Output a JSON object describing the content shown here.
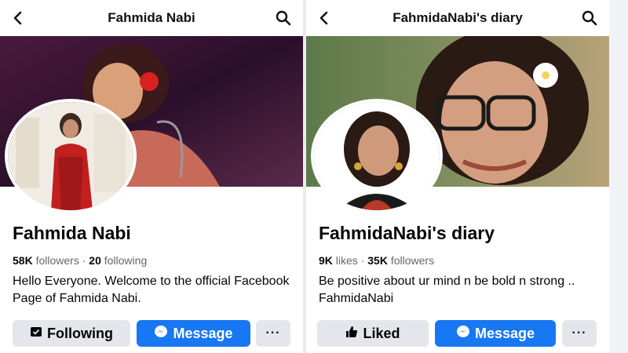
{
  "left": {
    "title": "Fahmida Nabi",
    "name": "Fahmida Nabi",
    "stat1_value": "58K",
    "stat1_label": "followers",
    "separator": "·",
    "stat2_value": "20",
    "stat2_label": "following",
    "bio": "Hello Everyone. Welcome to the official Facebook Page of Fahmida Nabi.",
    "primary_button": "Following",
    "message_button": "Message",
    "more_button": "···",
    "primary_icon": "following-icon"
  },
  "right": {
    "title": "FahmidaNabi's diary",
    "name": "FahmidaNabi's diary",
    "stat1_value": "9K",
    "stat1_label": "likes",
    "separator": "·",
    "stat2_value": "35K",
    "stat2_label": "followers",
    "bio": "Be positive about ur mind n be bold n strong .. FahmidaNabi",
    "primary_button": "Liked",
    "message_button": "Message",
    "more_button": "···",
    "primary_icon": "thumbs-up-icon"
  },
  "colors": {
    "brand_blue": "#1877f2",
    "button_grey": "#e4e6eb",
    "text_primary": "#050505",
    "text_secondary": "#65676b"
  }
}
